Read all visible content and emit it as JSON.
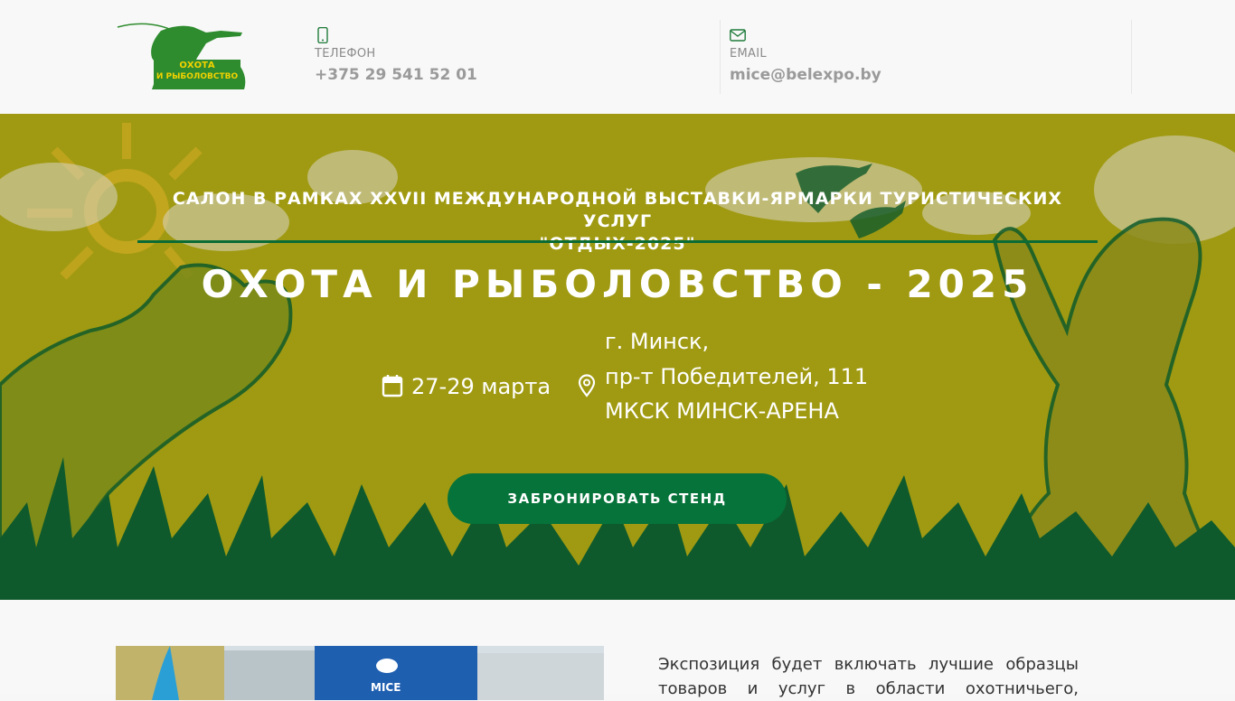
{
  "header": {
    "logo": {
      "text_line1": "ОХОТА",
      "text_line2": "И РЫБОЛОВСТВО",
      "colors": {
        "green": "#2e8b2e",
        "yellow": "#f2d200"
      }
    },
    "phone": {
      "icon": "mobile-phone-icon",
      "label": "ТЕЛЕФОН",
      "value": "+375 29 541 52 01"
    },
    "email": {
      "icon": "envelope-icon",
      "label": "EMAIL",
      "value": "mice@belexpo.by"
    }
  },
  "hero": {
    "subtitle_line1": "САЛОН В РАМКАХ XXVII МЕЖДУНАРОДНОЙ ВЫСТАВКИ-ЯРМАРКИ ТУРИСТИЧЕСКИХ УСЛУГ",
    "subtitle_line2": "\"ОТДЫХ-2025\"",
    "title": "ОХОТА И РЫБОЛОВСТВО - 2025",
    "date": {
      "icon": "calendar-icon",
      "text": "27-29 марта"
    },
    "location": {
      "icon": "location-pin-icon",
      "lines": [
        "г. Минск,",
        "пр-т Победителей, 111",
        "МКСК МИНСК-АРЕНА"
      ]
    },
    "cta_label": "ЗАБРОНИРОВАТЬ СТЕНД",
    "colors": {
      "background": "#a09a12",
      "accent_green": "#06733a",
      "divider": "#0b6b35"
    }
  },
  "about": {
    "photo_sign": "MICE",
    "text_line1": "Экспозиция будет включать лучшие образцы",
    "text_line2": "товаров и услуг в области охотничьего,"
  }
}
